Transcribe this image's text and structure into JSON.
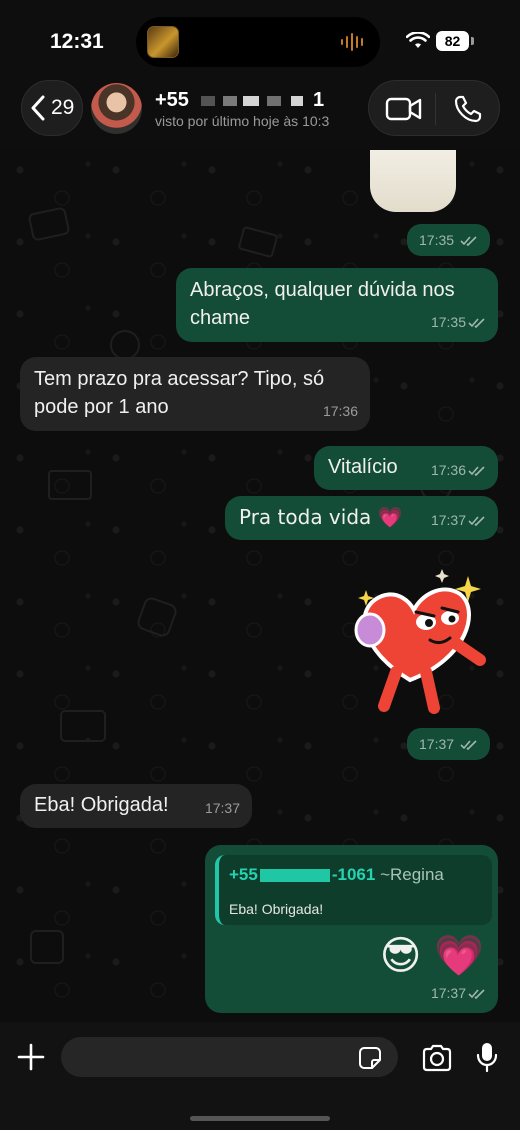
{
  "status_bar": {
    "time": "12:31",
    "battery": "82"
  },
  "header": {
    "back_count": "29",
    "contact_name": "+55",
    "contact_name_end": "1",
    "status": "visto por último hoje às 10:3"
  },
  "messages": [
    {
      "id": "m0",
      "type": "sticker_tick",
      "time": "17:35"
    },
    {
      "id": "m1",
      "direction": "out",
      "text": "Abraços, qualquer dúvida nos chame",
      "time": "17:35"
    },
    {
      "id": "m2",
      "direction": "in",
      "text": "Tem prazo pra acessar? Tipo, só pode por 1 ano",
      "time": "17:36"
    },
    {
      "id": "m3",
      "direction": "out",
      "text": "Vitalício",
      "time": "17:36"
    },
    {
      "id": "m4",
      "direction": "out",
      "text": "Pra toda vida 💗",
      "time": "17:37"
    },
    {
      "id": "m5",
      "type": "sticker",
      "sticker": "dancing-heart",
      "time": "17:37"
    },
    {
      "id": "m6",
      "direction": "in",
      "text": "Eba! Obrigada!",
      "time": "17:37"
    },
    {
      "id": "m7",
      "direction": "out",
      "reply": {
        "author_start": "+55",
        "author_end": "-1061",
        "alias": "~Regina",
        "text": "Eba! Obrigada!"
      },
      "text": "😎 💗",
      "time": "17:37"
    }
  ],
  "input": {
    "placeholder": ""
  },
  "icons": {
    "back": "chevron-left-icon",
    "video": "video-camera-icon",
    "phone": "phone-icon",
    "plus": "plus-icon",
    "sticker": "sticker-icon",
    "camera": "camera-icon",
    "mic": "microphone-icon",
    "read": "double-check-icon"
  },
  "colors": {
    "outgoing_bubble": "#144d37",
    "incoming_bubble": "#242424",
    "quote_accent": "#21c7a8",
    "background": "#0d0d0d"
  }
}
